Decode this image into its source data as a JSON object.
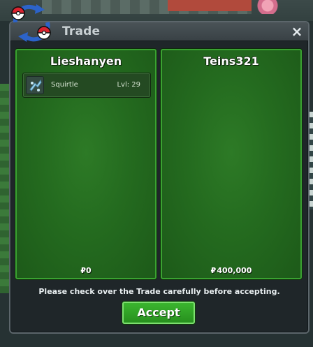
{
  "window": {
    "title": "Trade",
    "close_label": "×"
  },
  "trade": {
    "left": {
      "player_name": "Lieshanyen",
      "items": [
        {
          "name": "Squirtle",
          "level": "Lvl: 29",
          "icon": "pokemon-icon"
        }
      ],
      "money_symbol": "₽",
      "money": "0"
    },
    "right": {
      "player_name": "Teins321",
      "items": [],
      "money_symbol": "₽",
      "money": "400,000"
    }
  },
  "notice": "Please check over the Trade carefully before accepting.",
  "accept_label": "Accept",
  "colors": {
    "panel_green": "#246b1f",
    "panel_border": "#3aa231",
    "accept_green": "#3bb52f"
  }
}
